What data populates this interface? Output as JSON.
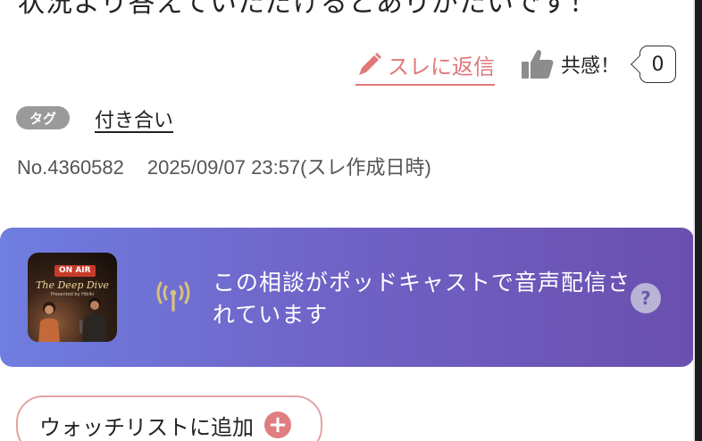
{
  "post": {
    "clipped_text": "状況より答えていただけるとありがたいです！"
  },
  "actions": {
    "reply_label": "スレに返信",
    "empathy_label": "共感！",
    "empathy_count": "0"
  },
  "tag": {
    "badge_label": "タグ",
    "value": "付き合い"
  },
  "meta": {
    "post_no": "No.4360582",
    "created": "2025/09/07 23:57(スレ作成日時)"
  },
  "podcast": {
    "thumbnail_badge": "ON AIR",
    "thumbnail_title": "The Deep Dive",
    "thumbnail_subtitle": "Presented by Hibiki",
    "message": "この相談がポッドキャストで音声配信されています",
    "help_glyph": "?",
    "icon": "broadcast-antenna-icon",
    "gradient_start": "#6f7ee0",
    "gradient_end": "#6a4fae"
  },
  "watchlist": {
    "label": "ウォッチリストに追加",
    "icon": "plus-circle-icon"
  },
  "colors": {
    "accent": "#e0787a",
    "tag_badge": "#9a9a9a",
    "antenna": "#d8c27a"
  }
}
